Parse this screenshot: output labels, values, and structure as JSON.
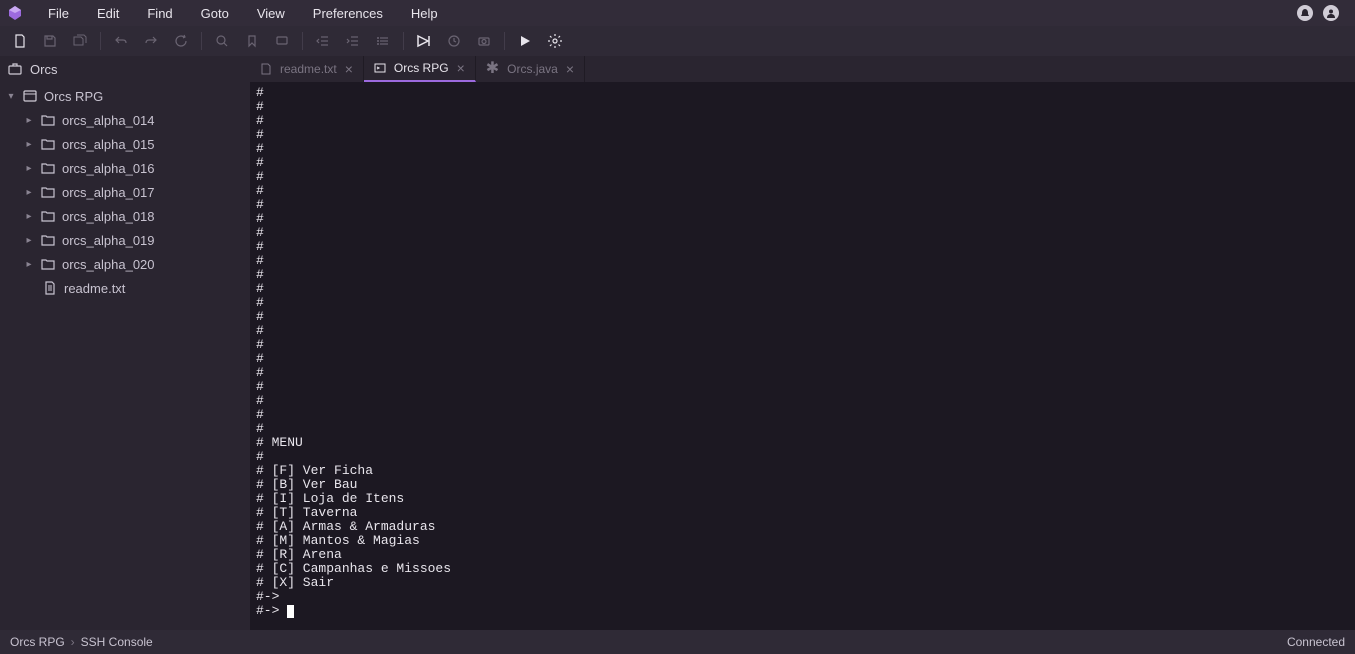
{
  "menubar": {
    "items": [
      "File",
      "Edit",
      "Find",
      "Goto",
      "View",
      "Preferences",
      "Help"
    ]
  },
  "sidebar": {
    "project_label": "Orcs",
    "root": "Orcs RPG",
    "folders": [
      "orcs_alpha_014",
      "orcs_alpha_015",
      "orcs_alpha_016",
      "orcs_alpha_017",
      "orcs_alpha_018",
      "orcs_alpha_019",
      "orcs_alpha_020"
    ],
    "files": [
      "readme.txt"
    ]
  },
  "tabs": [
    {
      "label": "readme.txt",
      "icon": "file",
      "active": false,
      "closable": true
    },
    {
      "label": "Orcs RPG",
      "icon": "terminal",
      "active": true,
      "closable": true
    },
    {
      "label": "Orcs.java",
      "icon": "unsaved",
      "active": false,
      "closable": true
    }
  ],
  "editor": {
    "lines": [
      "#",
      "#",
      "#",
      "#",
      "#",
      "#",
      "#",
      "#",
      "#",
      "#",
      "#",
      "#",
      "#",
      "#",
      "#",
      "#",
      "#",
      "#",
      "#",
      "#",
      "#",
      "#",
      "#",
      "#",
      "#",
      "# MENU",
      "#",
      "# [F] Ver Ficha",
      "# [B] Ver Bau",
      "# [I] Loja de Itens",
      "# [T] Taverna",
      "# [A] Armas & Armaduras",
      "# [M] Mantos & Magias",
      "# [R] Arena",
      "# [C] Campanhas e Missoes",
      "# [X] Sair",
      "#->",
      "#-> "
    ]
  },
  "statusbar": {
    "left1": "Orcs RPG",
    "left2": "SSH Console",
    "right": "Connected"
  }
}
